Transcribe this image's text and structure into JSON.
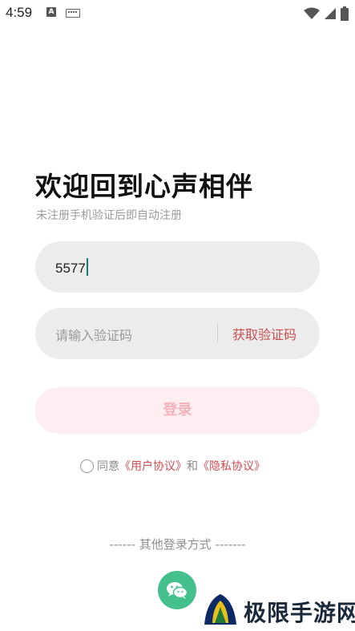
{
  "status_bar": {
    "time": "4:59",
    "left_icons": [
      "a-notification-icon",
      "keyboard-icon"
    ],
    "right_icons": [
      "wifi-icon",
      "signal-icon",
      "battery-icon"
    ]
  },
  "header": {
    "title": "欢迎回到心声相伴",
    "subtitle": "未注册手机验证后即自动注册"
  },
  "form": {
    "phone_value": "5577",
    "code_placeholder": "请输入验证码",
    "get_code_label": "获取验证码",
    "login_label": "登录"
  },
  "agreement": {
    "prefix": "同意",
    "user_agreement": "《用户协议》",
    "conjunction": "和",
    "privacy_agreement": "《隐私协议》",
    "checked": false
  },
  "other_login": {
    "label": "------ 其他登录方式 -------"
  },
  "watermark": {
    "text": "极限手游网"
  },
  "colors": {
    "accent": "#c8504e",
    "login_bg": "#fdeff1",
    "login_text": "#f4b3bb",
    "field_bg": "#ececec",
    "wechat": "#44c08d"
  }
}
